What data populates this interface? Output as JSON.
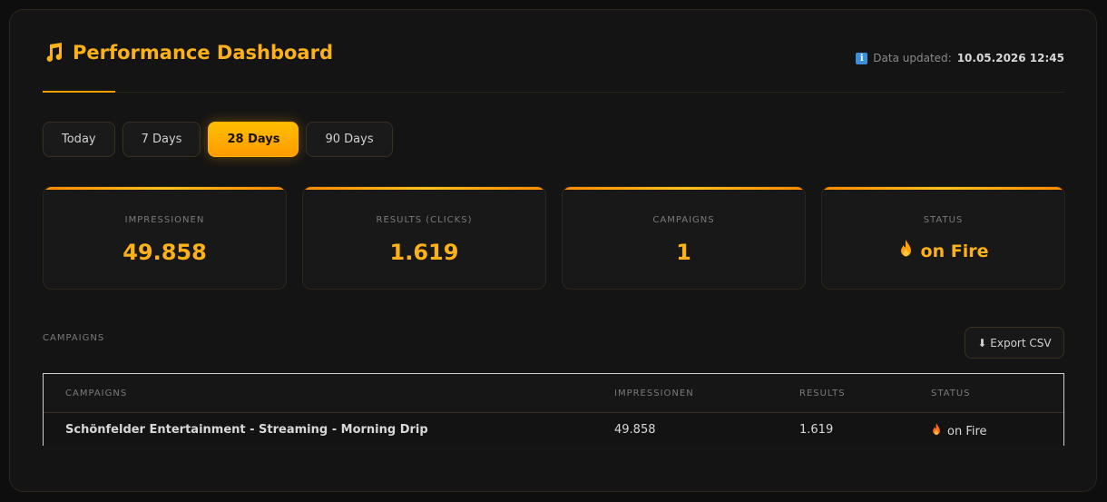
{
  "header": {
    "title": "Performance Dashboard",
    "updated_label": "Data updated:",
    "updated_value": "10.05.2026 12:45"
  },
  "ranges": [
    {
      "label": "Today",
      "active": false
    },
    {
      "label": "7 Days",
      "active": false
    },
    {
      "label": "28 Days",
      "active": true
    },
    {
      "label": "90 Days",
      "active": false
    }
  ],
  "cards": {
    "impressions": {
      "label": "IMPRESSIONEN",
      "value": "49.858"
    },
    "results": {
      "label": "RESULTS (CLICKS)",
      "value": "1.619"
    },
    "campaigns": {
      "label": "CAMPAIGNS",
      "value": "1"
    },
    "status": {
      "label": "STATUS",
      "value": "on Fire"
    }
  },
  "campaigns_section": {
    "label": "CAMPAIGNS",
    "export_label": "⬇ Export CSV"
  },
  "table": {
    "headers": [
      "CAMPAIGNS",
      "IMPRESSIONEN",
      "RESULTS",
      "STATUS"
    ],
    "rows": [
      {
        "name": "Schönfelder Entertainment - Streaming - Morning Drip",
        "impressions": "49.858",
        "results": "1.619",
        "status": "on Fire"
      }
    ]
  },
  "colors": {
    "accent": "#fbb117",
    "active_button": "#ffb000",
    "background": "#141414"
  },
  "icons": {
    "title": "music-note-icon",
    "updated": "info-icon",
    "status": "fire-icon"
  }
}
